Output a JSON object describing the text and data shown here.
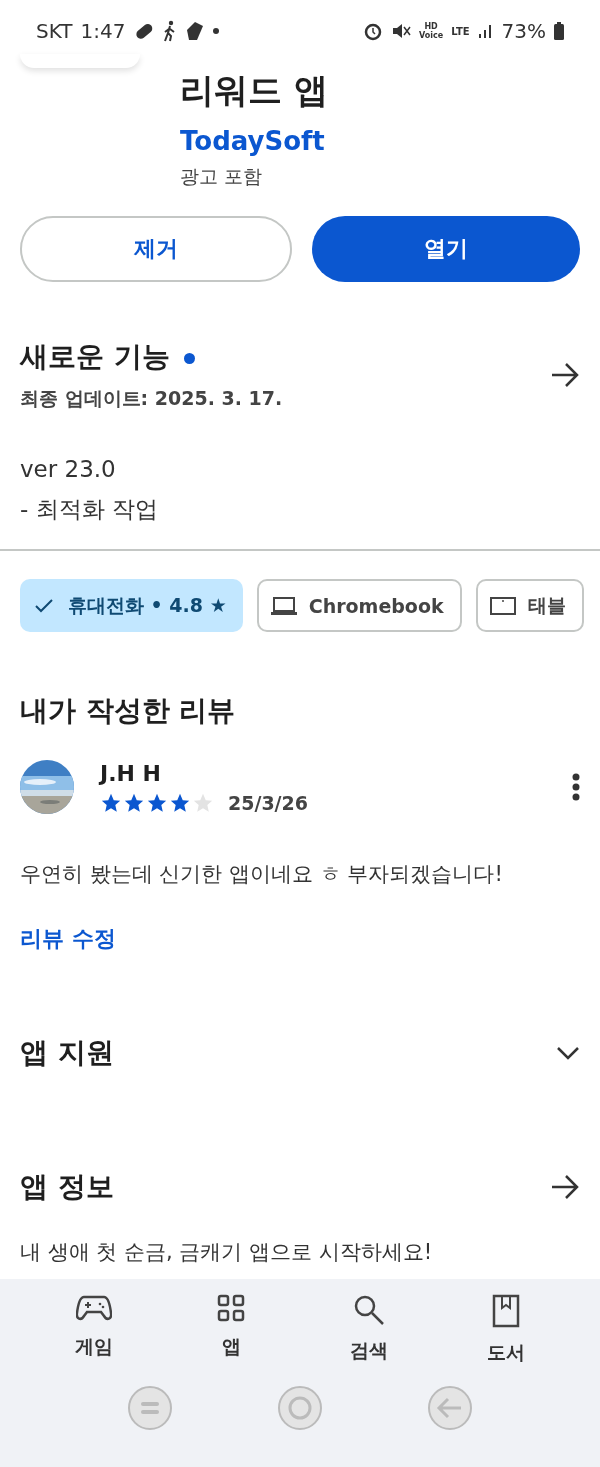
{
  "status_bar": {
    "carrier": "SKT",
    "time": "1:47",
    "hd_label": "HD",
    "voice_label": "Voice",
    "network": "LTE",
    "battery": "73%"
  },
  "app": {
    "title": "리워드 앱",
    "developer": "TodaySoft",
    "ads_note": "광고 포함"
  },
  "actions": [
    {
      "label": "제거",
      "kind": "outline"
    },
    {
      "label": "열기",
      "kind": "filled"
    }
  ],
  "whats_new": {
    "title": "새로운 기능",
    "updated": "최종 업데이트: 2025. 3. 17.",
    "version": "ver 23.0",
    "notes": "- 최적화 작업"
  },
  "device_chips": [
    {
      "label": "휴대전화 • 4.8 ★",
      "kind": "phone",
      "selected": true
    },
    {
      "label": "Chromebook",
      "kind": "laptop",
      "selected": false
    },
    {
      "label": "태블",
      "kind": "tablet",
      "selected": false
    }
  ],
  "my_review": {
    "title": "내가 작성한 리뷰",
    "author": "J.H H",
    "stars": 4,
    "date": "25/3/26",
    "text": "우연히 봤는데 신기한 앱이네요 ㅎ 부자되겠습니다!",
    "edit_link": "리뷰 수정"
  },
  "sections": [
    {
      "title": "앱 지원",
      "kind": "expand"
    },
    {
      "title": "앱 정보",
      "kind": "arrow",
      "description": "내 생애 첫 순금, 금캐기 앱으로 시작하세요!"
    }
  ],
  "bottom_nav": [
    {
      "label": "게임",
      "kind": "games"
    },
    {
      "label": "앱",
      "kind": "apps"
    },
    {
      "label": "검색",
      "kind": "search"
    },
    {
      "label": "도서",
      "kind": "books"
    }
  ]
}
